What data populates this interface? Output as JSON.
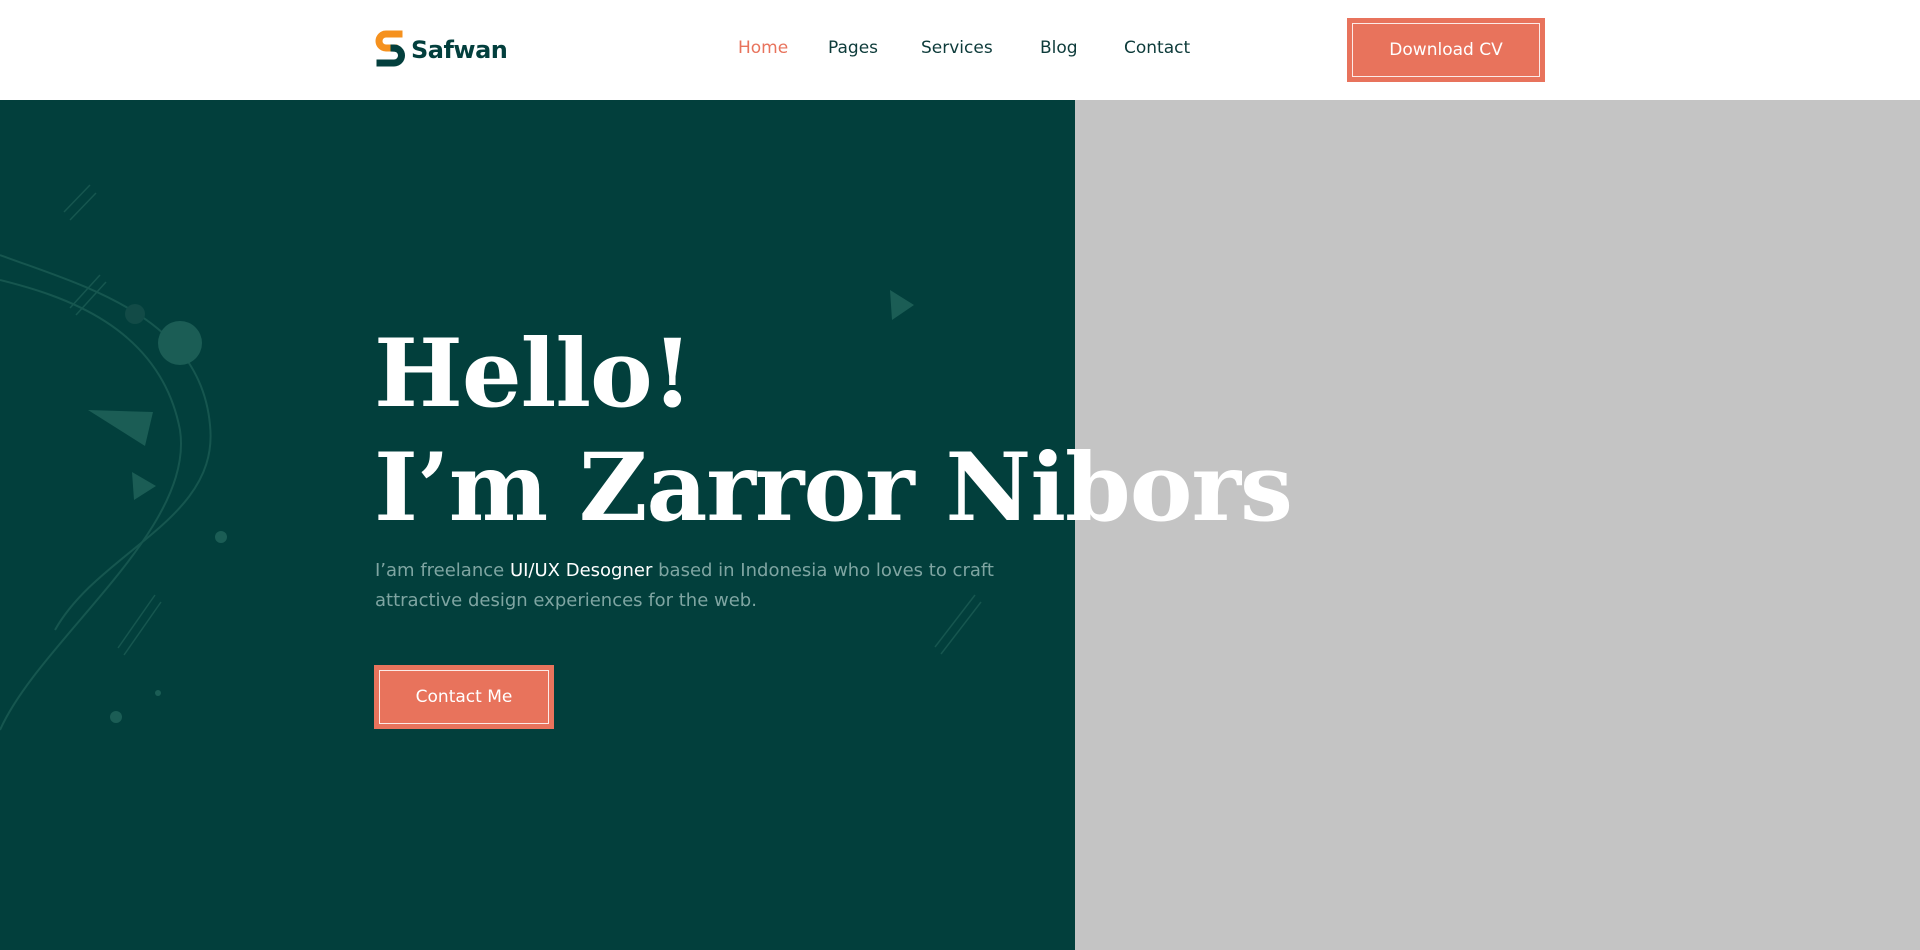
{
  "brand": {
    "name": "Safwan"
  },
  "nav": {
    "items": [
      {
        "label": "Home",
        "active": true
      },
      {
        "label": "Pages",
        "active": false
      },
      {
        "label": "Services",
        "active": false
      },
      {
        "label": "Blog",
        "active": false
      },
      {
        "label": "Contact",
        "active": false
      }
    ]
  },
  "header": {
    "cta_label": "Download CV"
  },
  "hero": {
    "greeting": "Hello!",
    "name_line": "I’m Zarror Nibors",
    "intro_before": "I’am freelance",
    "intro_highlight": "UI/UX Desogner",
    "intro_after": "based in Indonesia who loves to craft attractive design experiences for the web.",
    "cta_label": "Contact Me"
  },
  "colors": {
    "primary_dark": "#023f3c",
    "accent": "#e8735c",
    "logo_orange": "#f5911e",
    "image_placeholder": "#c4c4c4"
  },
  "icons": [
    "logo-mark-icon"
  ]
}
